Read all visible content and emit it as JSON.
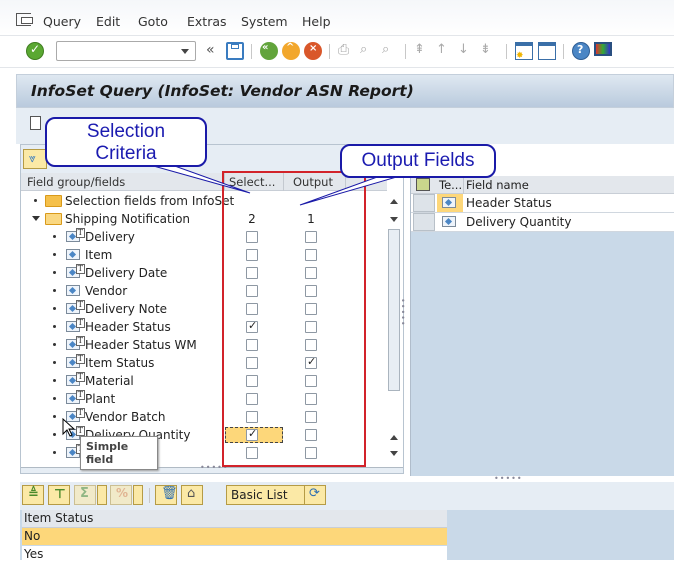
{
  "menubar": {
    "items": [
      "Query",
      "Edit",
      "Goto",
      "Extras",
      "System",
      "Help"
    ]
  },
  "toolbar": {
    "command_field_value": "",
    "icons": [
      "enter-icon",
      "command-dropdown-icon",
      "collapse-icon",
      "save-icon",
      "back-icon",
      "exit-icon",
      "cancel-icon",
      "print-icon",
      "find-icon",
      "find-next-icon",
      "first-page-icon",
      "previous-page-icon",
      "next-page-icon",
      "last-page-icon",
      "create-session-icon",
      "shortcut-icon",
      "help-icon",
      "customize-layout-icon"
    ]
  },
  "title": "InfoSet Query (InfoSet: Vendor ASN Report)",
  "callouts": {
    "selection": "Selection Criteria",
    "output": "Output Fields"
  },
  "tree": {
    "headers": {
      "field": "Field group/fields",
      "select": "Select...",
      "output": "Output"
    },
    "groups": [
      {
        "label": "Selection fields from InfoSet",
        "expanded": false
      },
      {
        "label": "Shipping Notification",
        "expanded": true,
        "select_count": "2",
        "output_count": "1"
      }
    ],
    "fields": [
      {
        "label": "Delivery",
        "select": false,
        "output": false
      },
      {
        "label": "Item",
        "select": false,
        "output": false
      },
      {
        "label": "Delivery Date",
        "select": false,
        "output": false
      },
      {
        "label": "Vendor",
        "select": false,
        "output": false
      },
      {
        "label": "Delivery Note",
        "select": false,
        "output": false
      },
      {
        "label": "Header Status",
        "select": true,
        "output": false
      },
      {
        "label": "Header Status WM",
        "select": false,
        "output": false
      },
      {
        "label": "Item Status",
        "select": false,
        "output": true
      },
      {
        "label": "Material",
        "select": false,
        "output": false
      },
      {
        "label": "Plant",
        "select": false,
        "output": false
      },
      {
        "label": "Vendor Batch",
        "select": false,
        "output": false
      },
      {
        "label": "Delivery Quantity",
        "select": true,
        "output": false
      },
      {
        "label": "",
        "select": false,
        "output": false
      }
    ],
    "tooltip": "Simple field"
  },
  "selection_fields": {
    "headers": {
      "type": "Te...",
      "name": "Field name"
    },
    "rows": [
      "Header Status",
      "Delivery Quantity"
    ]
  },
  "bottom": {
    "layout_select": "Basic List",
    "list_header": "Item Status",
    "list_rows": [
      "No",
      "Yes"
    ],
    "highlight_color": "#fdd77a"
  }
}
